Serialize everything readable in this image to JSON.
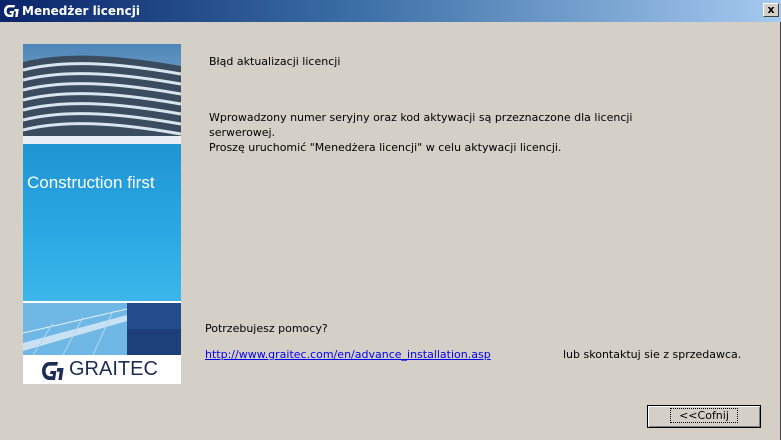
{
  "window": {
    "title": "Menedżer licencji",
    "close_label": "x"
  },
  "banner": {
    "slogan": "Construction first",
    "logo_text": "GRAITEC"
  },
  "content": {
    "heading": "Błąd aktualizacji licencji",
    "message_line1": "Wprowadzony numer seryjny oraz kod aktywacji są przeznaczone dla licencji",
    "message_line2": "serwerowej.",
    "message_line3": "Proszę uruchomić \"Menedżera licencji\" w celu aktywacji licencji.",
    "help_prompt": "Potrzebujesz pomocy?",
    "help_link": "http://www.graitec.com/en/advance_installation.asp",
    "help_suffix": "lub skontaktuj sie z sprzedawca."
  },
  "buttons": {
    "back_label": "<<Cofnij"
  },
  "colors": {
    "titlebar_start": "#0a246a",
    "titlebar_end": "#a6caf0",
    "dialog_bg": "#d4d0c8",
    "banner_blue": "#2aa8e3",
    "link": "#0000ee"
  }
}
